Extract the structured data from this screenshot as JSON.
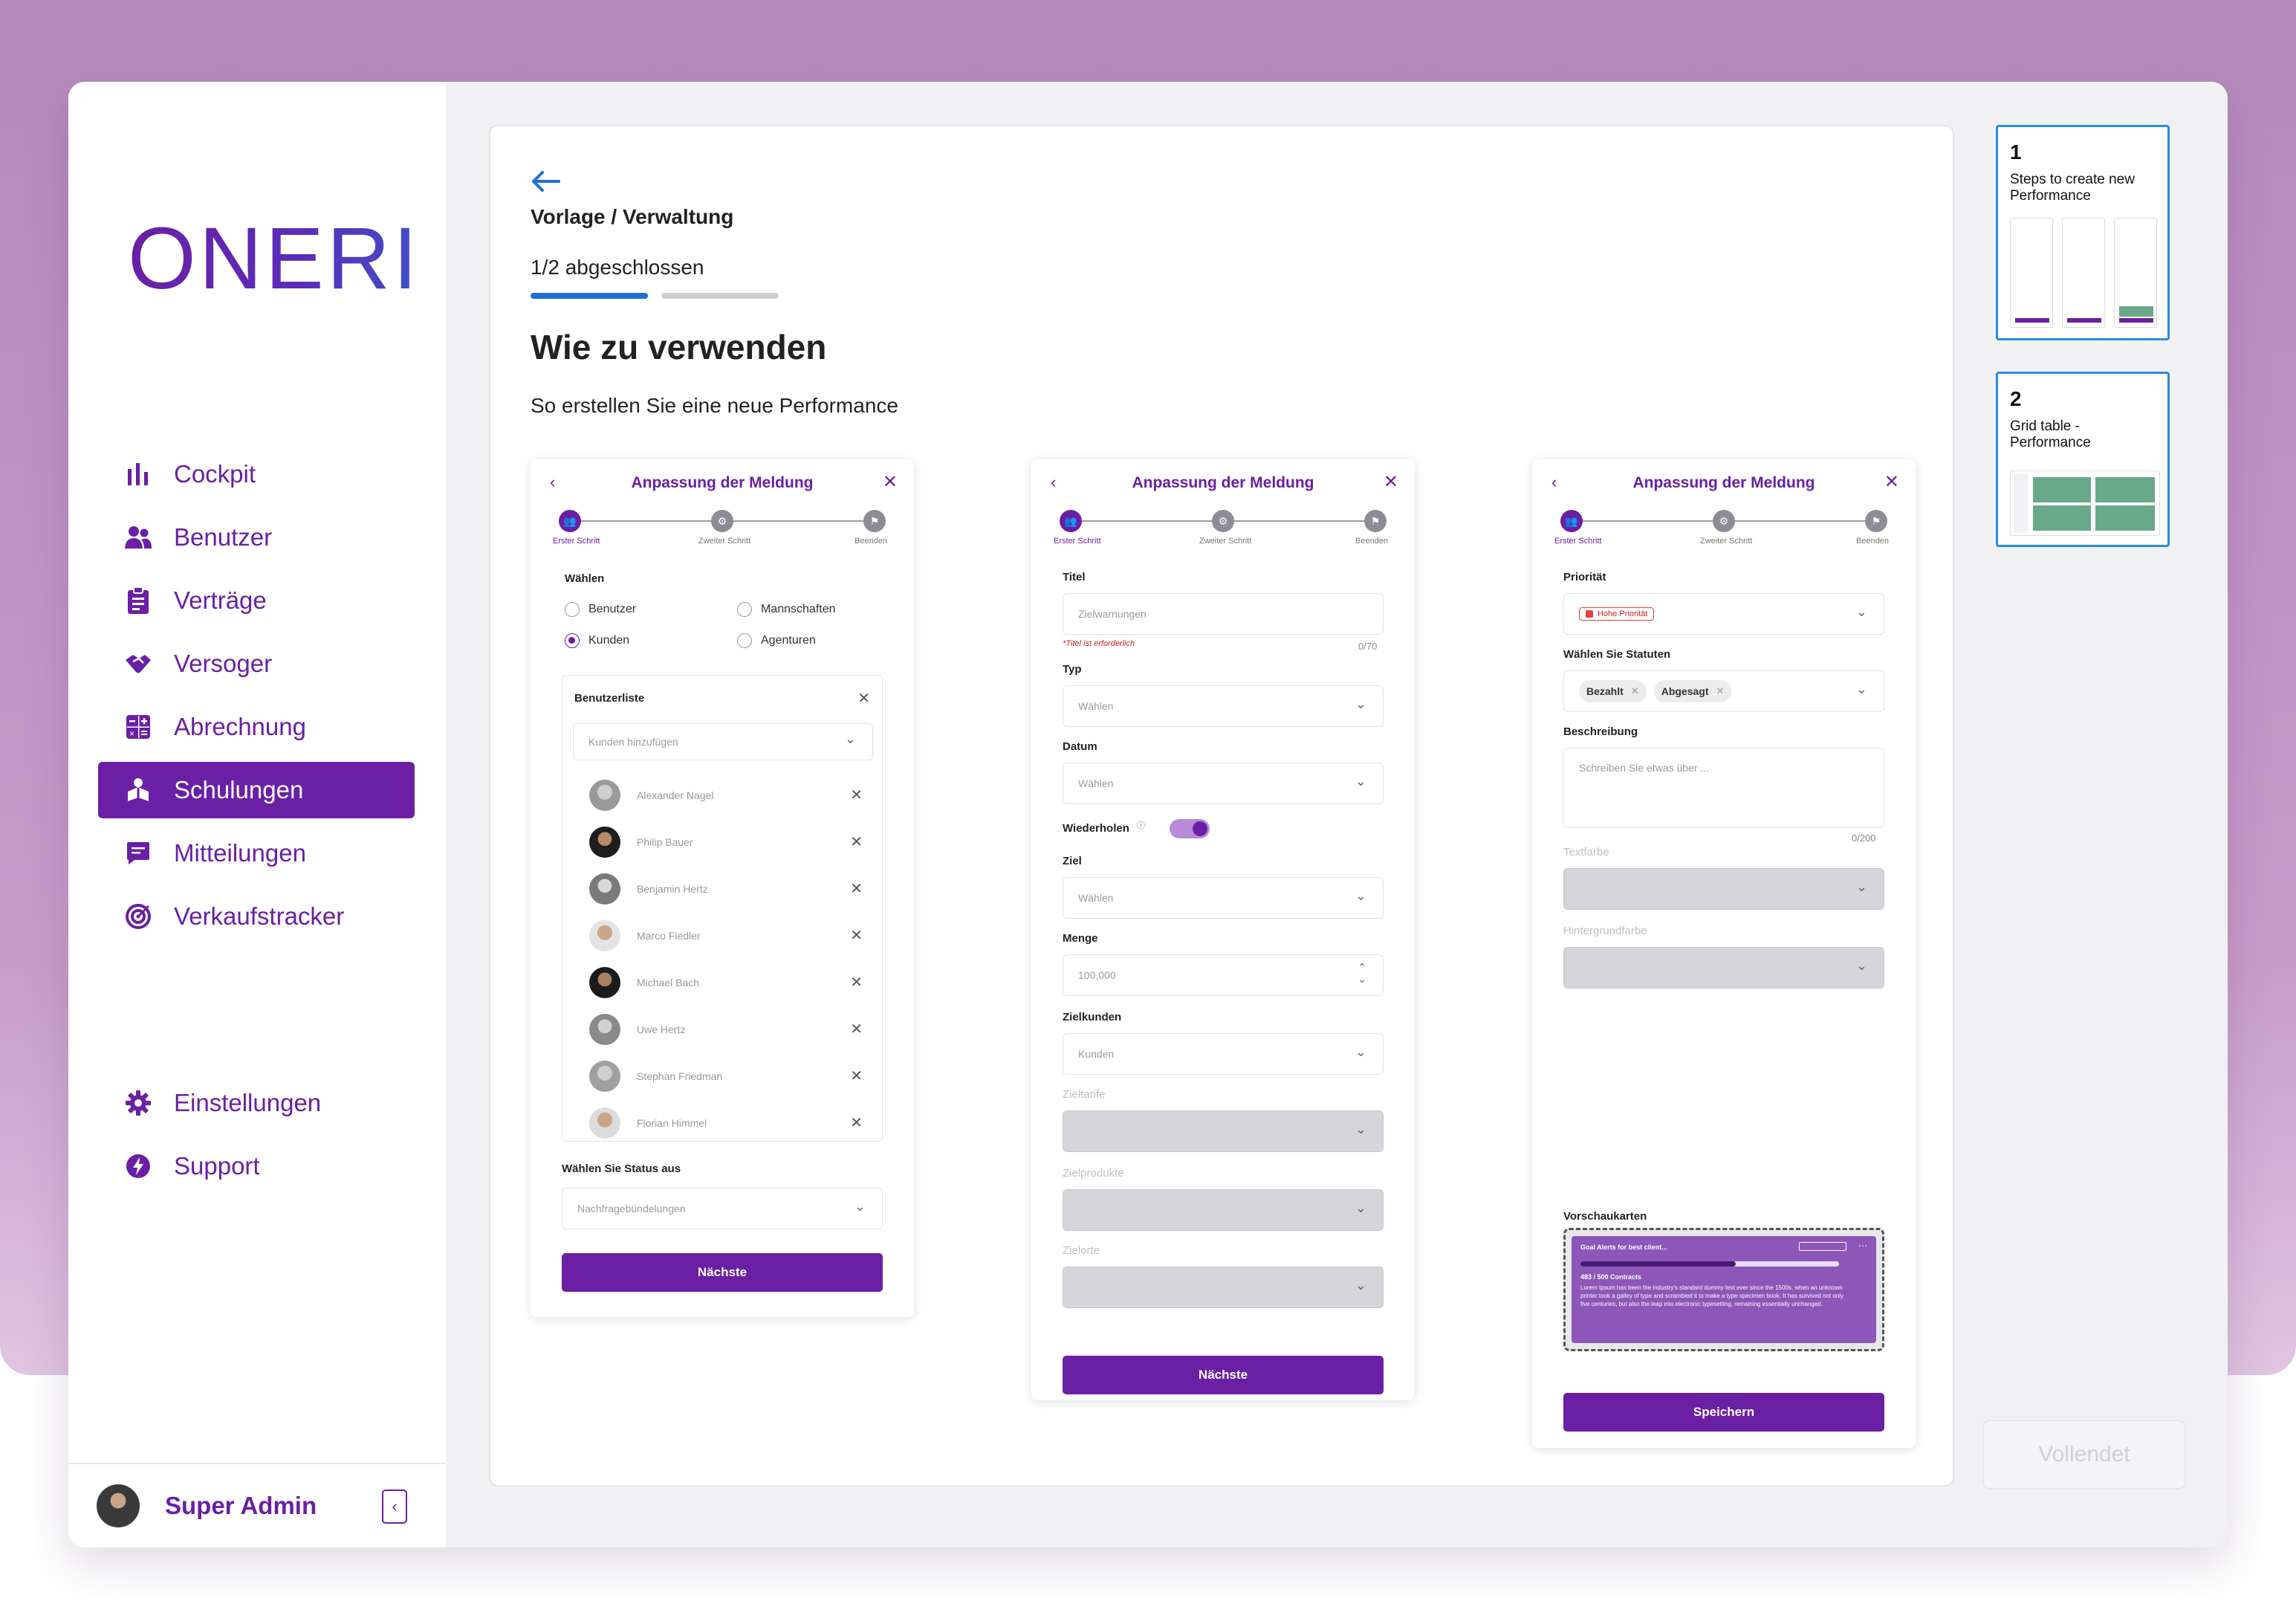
{
  "brand": {
    "logo_text": "ONERI",
    "accent": "#6a1fa5",
    "link_blue": "#1e6fd6"
  },
  "sidebar": {
    "items": [
      {
        "label": "Cockpit",
        "icon": "bar-chart-icon"
      },
      {
        "label": "Benutzer",
        "icon": "users-icon"
      },
      {
        "label": "Verträge",
        "icon": "clipboard-icon"
      },
      {
        "label": "Versoger",
        "icon": "handshake-icon"
      },
      {
        "label": "Abrechnung",
        "icon": "calculator-icon"
      },
      {
        "label": "Schulungen",
        "icon": "training-icon",
        "active": true
      },
      {
        "label": "Mitteilungen",
        "icon": "message-icon"
      },
      {
        "label": "Verkaufstracker",
        "icon": "target-icon"
      }
    ],
    "bottom_items": [
      {
        "label": "Einstellungen",
        "icon": "gear-icon"
      },
      {
        "label": "Support",
        "icon": "bolt-icon"
      }
    ],
    "user": {
      "name": "Super Admin"
    }
  },
  "main": {
    "breadcrumb": "Vorlage / Verwaltung",
    "progress_label": "1/2 abgeschlossen",
    "progress": {
      "completed": 1,
      "total": 2
    },
    "heading": "Wie zu verwenden",
    "subheading": "So erstellen Sie eine neue Performance"
  },
  "form_common": {
    "title": "Anpassung der Meldung",
    "steps": [
      "Erster Schritt",
      "Zweiter Schritt",
      "Beenden"
    ]
  },
  "form1": {
    "choose_label": "Wählen",
    "radios": [
      {
        "label": "Benutzer",
        "checked": false
      },
      {
        "label": "Mannschaften",
        "checked": false
      },
      {
        "label": "Kunden",
        "checked": true
      },
      {
        "label": "Agenturen",
        "checked": false
      }
    ],
    "userlist_title": "Benutzerliste",
    "add_placeholder": "Kunden hinzufügen",
    "users": [
      "Alexander Nagel",
      "Philip Bauer",
      "Benjamin Hertz",
      "Marco Fiedler",
      "Michael Bach",
      "Uwe Hertz",
      "Stephan Friedman",
      "Florian Himmel"
    ],
    "status_label": "Wählen Sie Status aus",
    "status_value": "Nachfragebündelungen",
    "next": "Nächste"
  },
  "form2": {
    "title_label": "Titel",
    "title_placeholder": "Zielwarnungen",
    "title_error": "*Titel ist erforderlich",
    "title_counter": "0/70",
    "type_label": "Typ",
    "type_value": "Wählen",
    "date_label": "Datum",
    "date_value": "Wählen",
    "repeat_label": "Wiederholen",
    "goal_label": "Ziel",
    "goal_value": "Wählen",
    "amount_label": "Menge",
    "amount_value": "100,000",
    "target_customers_label": "Zielkunden",
    "target_customers_value": "Kunden",
    "disabled_labels": [
      "Zieltarife",
      "Zielprodukte",
      "Zielorte"
    ],
    "next": "Nächste"
  },
  "form3": {
    "priority_label": "Priorität",
    "priority_value": "Hohe Priorität",
    "status_label": "Wählen Sie Statuten",
    "status_chips": [
      "Bezahlt",
      "Abgesagt"
    ],
    "description_label": "Beschreibung",
    "description_placeholder": "Schreiben Sie etwas über ...",
    "description_counter": "0/200",
    "text_color_label": "Textfarbe",
    "bg_color_label": "Hintergrundfarbe",
    "preview_label": "Vorschaukarten",
    "preview": {
      "title": "Goal Alerts for best client...",
      "count": "483 / 500 Contracts",
      "body": "Lorem Ipsum has been the industry's standard dummy text ever since the 1500s, when an unknown printer took a galley of type and scrambled it to make a type specimen book. It has survived not only five centuries, but also the leap into electronic typesetting, remaining essentially unchanged."
    },
    "save": "Speichern"
  },
  "thumbnails": [
    {
      "number": "1",
      "title": "Steps to create new Performance"
    },
    {
      "number": "2",
      "title": "Grid table - Performance"
    }
  ],
  "done_button": "Vollendet"
}
